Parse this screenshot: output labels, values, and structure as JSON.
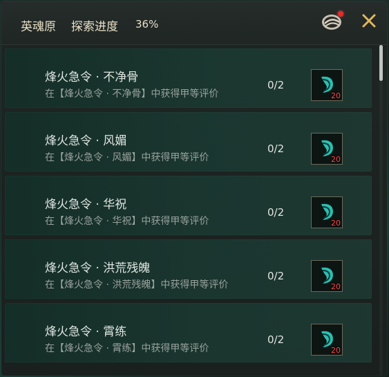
{
  "header": {
    "title": "英魂原",
    "progress_label": "探索进度",
    "progress_value": "36%",
    "scroll_icon": "scroll-icon",
    "close_icon": "close-icon"
  },
  "colors": {
    "accent": "#e3b85a",
    "reward_count": "#ff4a4a",
    "notification_dot": "#e62a2a"
  },
  "items": [
    {
      "name": "烽火急令 · 不净骨",
      "desc": "在【烽火急令 · 不净骨】中获得甲等评价",
      "progress": "0/2",
      "reward_icon": "feather-scroll-icon",
      "reward_qty": "20"
    },
    {
      "name": "烽火急令 · 风媚",
      "desc": "在【烽火急令 · 风媚】中获得甲等评价",
      "progress": "0/2",
      "reward_icon": "feather-scroll-icon",
      "reward_qty": "20"
    },
    {
      "name": "烽火急令 · 华祝",
      "desc": "在【烽火急令 · 华祝】中获得甲等评价",
      "progress": "0/2",
      "reward_icon": "feather-scroll-icon",
      "reward_qty": "20"
    },
    {
      "name": "烽火急令 · 洪荒残魄",
      "desc": "在【烽火急令 · 洪荒残魄】中获得甲等评价",
      "progress": "0/2",
      "reward_icon": "feather-scroll-icon",
      "reward_qty": "20"
    },
    {
      "name": "烽火急令 · 霄练",
      "desc": "在【烽火急令 · 霄练】中获得甲等评价",
      "progress": "0/2",
      "reward_icon": "feather-scroll-icon",
      "reward_qty": "20"
    }
  ]
}
